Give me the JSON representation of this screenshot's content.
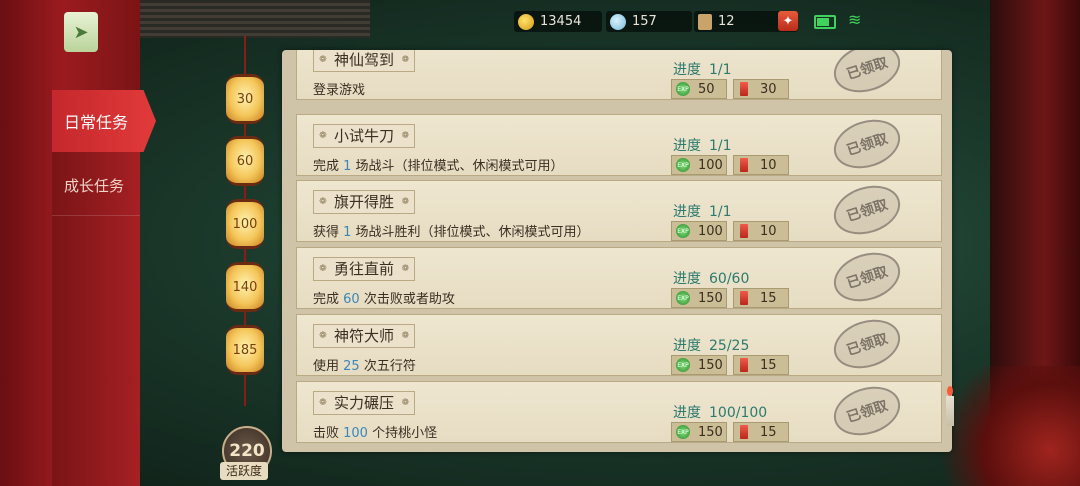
{
  "resources": {
    "gold": "13454",
    "gem": "157",
    "ticket": "12",
    "plus": "✦"
  },
  "menu": {
    "daily": "日常任务",
    "growth": "成长任务"
  },
  "lanterns": [
    "30",
    "60",
    "100",
    "140",
    "185"
  ],
  "activity": {
    "value": "220",
    "label": "活跃度"
  },
  "progress_label": "进度",
  "claimed_label": "已领取",
  "tasks": [
    {
      "name": "神仙驾到",
      "desc_pre": "登录游戏",
      "desc_num": "",
      "desc_post": "",
      "progress": "1/1",
      "exp": "50",
      "ticket": "30"
    },
    {
      "name": "小试牛刀",
      "desc_pre": "完成 ",
      "desc_num": "1",
      "desc_post": " 场战斗（排位模式、休闲模式可用）",
      "progress": "1/1",
      "exp": "100",
      "ticket": "10"
    },
    {
      "name": "旗开得胜",
      "desc_pre": "获得 ",
      "desc_num": "1",
      "desc_post": " 场战斗胜利（排位模式、休闲模式可用）",
      "progress": "1/1",
      "exp": "100",
      "ticket": "10"
    },
    {
      "name": "勇往直前",
      "desc_pre": "完成 ",
      "desc_num": "60",
      "desc_post": " 次击败或者助攻",
      "progress": "60/60",
      "exp": "150",
      "ticket": "15"
    },
    {
      "name": "神符大师",
      "desc_pre": "使用 ",
      "desc_num": "25",
      "desc_post": " 次五行符",
      "progress": "25/25",
      "exp": "150",
      "ticket": "15"
    },
    {
      "name": "实力碾压",
      "desc_pre": "击败 ",
      "desc_num": "100",
      "desc_post": " 个持桃小怪",
      "progress": "100/100",
      "exp": "150",
      "ticket": "15"
    }
  ],
  "icons": {
    "exp": "EXP",
    "accent": "#c4282c"
  }
}
